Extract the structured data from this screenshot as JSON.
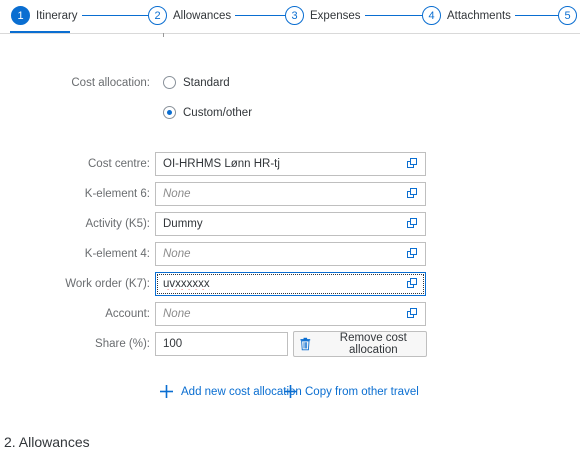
{
  "wizard": {
    "steps": [
      {
        "num": "1",
        "label": "Itinerary"
      },
      {
        "num": "2",
        "label": "Allowances"
      },
      {
        "num": "3",
        "label": "Expenses"
      },
      {
        "num": "4",
        "label": "Attachments"
      },
      {
        "num": "5",
        "label": ""
      }
    ],
    "active_step": 1
  },
  "cost_allocation": {
    "label": "Cost allocation:",
    "options": [
      {
        "label": "Standard",
        "selected": false
      },
      {
        "label": "Custom/other",
        "selected": true
      }
    ]
  },
  "fields": {
    "cost_centre": {
      "label": "Cost centre:",
      "value": "OI-HRHMS Lønn HR-tj",
      "placeholder": ""
    },
    "k_element_6": {
      "label": "K-element 6:",
      "value": "",
      "placeholder": "None"
    },
    "activity": {
      "label": "Activity (K5):",
      "value": "Dummy",
      "placeholder": ""
    },
    "k_element_4": {
      "label": "K-element 4:",
      "value": "",
      "placeholder": "None"
    },
    "work_order": {
      "label": "Work order (K7):",
      "value": "uvxxxxxx",
      "placeholder": ""
    },
    "account": {
      "label": "Account:",
      "value": "",
      "placeholder": "None"
    },
    "share": {
      "label": "Share (%):",
      "value": "100",
      "placeholder": ""
    }
  },
  "buttons": {
    "remove_cost_allocation": "Remove cost allocation",
    "add_new_cost_allocation": "Add new cost allocation",
    "copy_from_other_travel": "Copy from other travel"
  },
  "next_section": "2. Allowances",
  "colors": {
    "accent": "#0a6ed1",
    "text": "#32363a",
    "label": "#6a6d70"
  }
}
